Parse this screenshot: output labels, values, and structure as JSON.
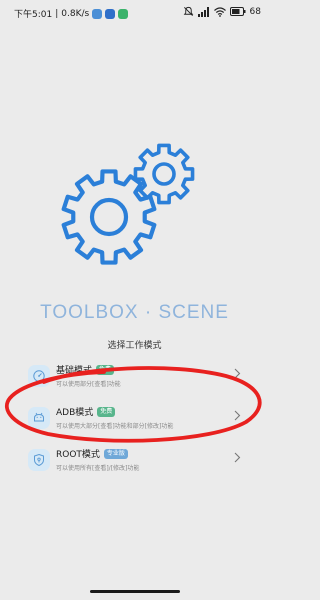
{
  "status_bar": {
    "time": "下午5:01",
    "separator": "|",
    "net_speed": "0.8K/s",
    "battery": "68"
  },
  "brand": {
    "title": "TOOLBOX · SCENE",
    "subtitle": "选择工作模式"
  },
  "modes": [
    {
      "label": "基础模式",
      "tag": "免费",
      "desc": "可以使用部分[查看]功能",
      "icon": "speedometer-icon"
    },
    {
      "label": "ADB模式",
      "tag": "免费",
      "desc": "可以使用大部分[查看]功能和部分[修改]功能",
      "icon": "android-icon"
    },
    {
      "label": "ROOT模式",
      "tag": "专业版",
      "desc": "可以使用所有[查看]/[修改]功能",
      "icon": "shield-icon"
    }
  ],
  "colors": {
    "accent": "#2b7fd8",
    "free_tag": "#58b58c",
    "pro_tag": "#6fa8d8",
    "annotation": "#e8211f"
  }
}
